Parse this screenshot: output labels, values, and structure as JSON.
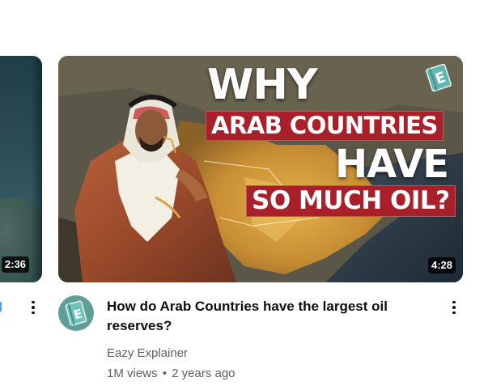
{
  "left_card": {
    "duration": "2:36"
  },
  "video": {
    "thumbnail_text": {
      "line1": "WHY",
      "line2": "ARAB COUNTRIES",
      "line3": "HAVE",
      "line4": "SO MUCH OIL?"
    },
    "duration": "4:28",
    "title": "How do Arab Countries have the largest oil reserves?",
    "channel": "Eazy Explainer",
    "views": "1M views",
    "separator": "•",
    "age": "2 years ago",
    "badge_letter": "E"
  },
  "icons": {
    "more": "kebab-vertical-icon",
    "channel_logo": "book-e-icon"
  },
  "colors": {
    "banner_red": "#a8202a",
    "badge_teal": "#5fb8b0",
    "link_blue": "#3ea6ff",
    "meta_gray": "#606060"
  }
}
